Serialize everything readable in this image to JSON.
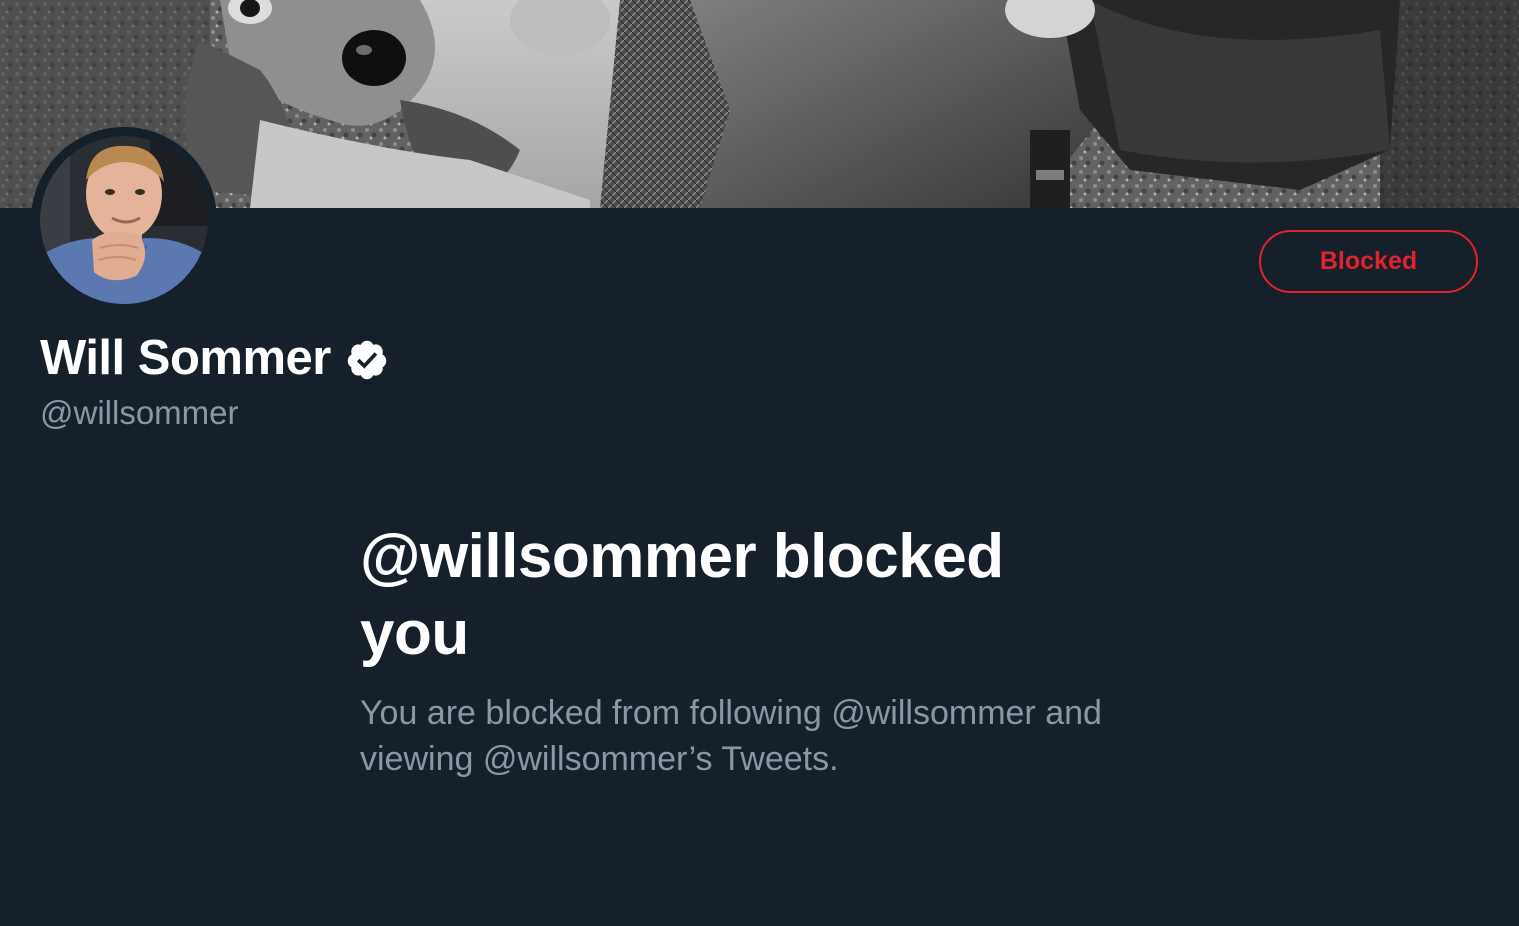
{
  "banner": {
    "alt": "Profile banner"
  },
  "avatar": {
    "alt": "Profile photo"
  },
  "actions": {
    "blocked_label": "Blocked"
  },
  "profile": {
    "name": "Will Sommer",
    "handle": "@willsommer",
    "verified": true
  },
  "blocked_notice": {
    "title": "@willsommer blocked you",
    "description": "You are blocked from following @willsommer and viewing @willsommer’s Tweets."
  },
  "colors": {
    "background": "#15202b",
    "accent_red": "#e0232e",
    "secondary_text": "#8899a6",
    "primary_text": "#ffffff"
  }
}
